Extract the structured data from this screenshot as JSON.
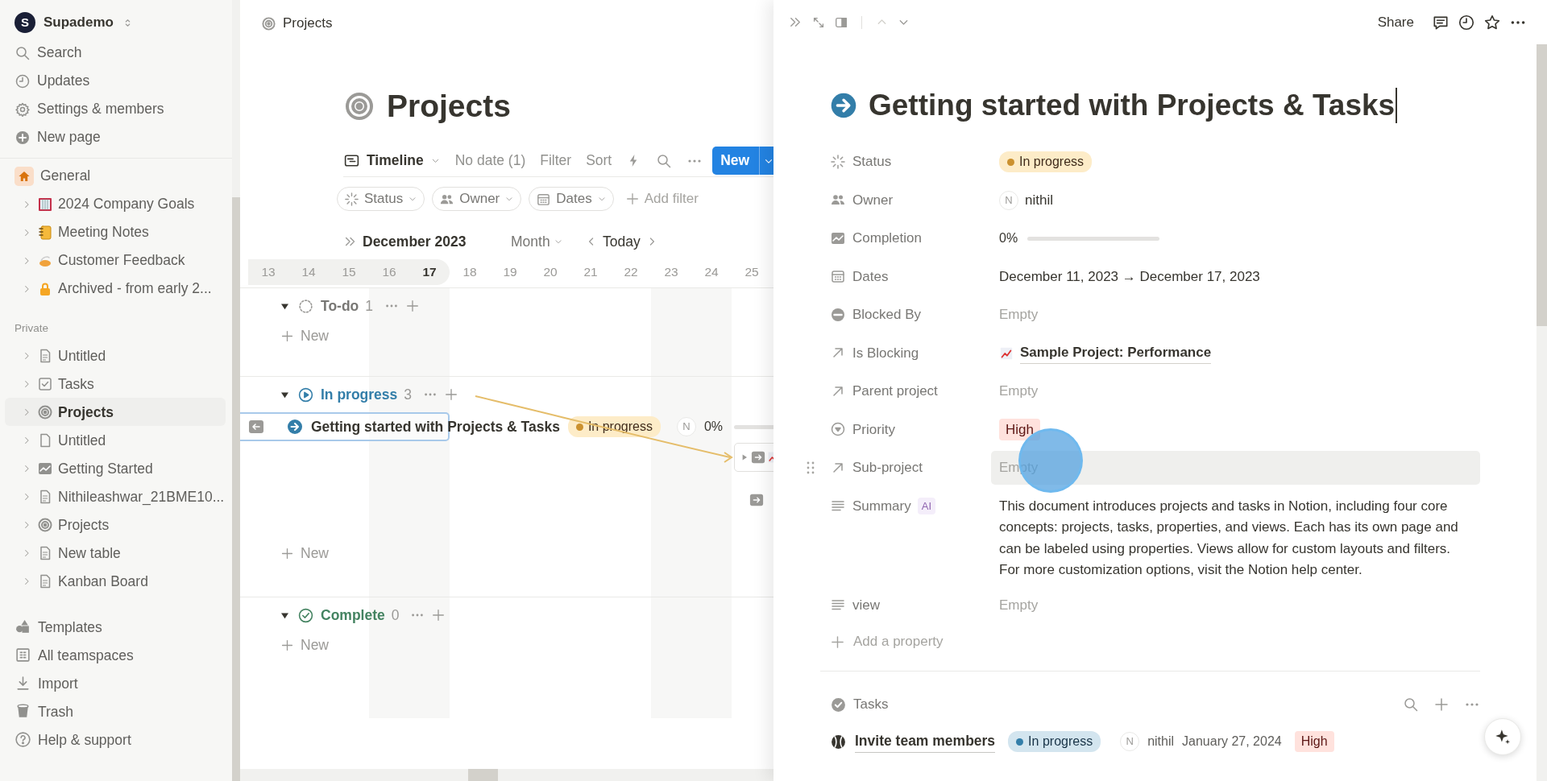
{
  "workspace": {
    "initial": "S",
    "name": "Supademo"
  },
  "sidebar": {
    "top_items": [
      {
        "label": "Search",
        "kind": "search"
      },
      {
        "label": "Updates",
        "kind": "clock"
      },
      {
        "label": "Settings & members",
        "kind": "gear"
      },
      {
        "label": "New page",
        "kind": "plus"
      }
    ],
    "teamspace": {
      "label": "General",
      "kind": "house"
    },
    "teamspace_items": [
      {
        "label": "2024 Company Goals",
        "kind": "frame",
        "selected": false
      },
      {
        "label": "Meeting Notes",
        "kind": "notebook",
        "selected": false
      },
      {
        "label": "Customer Feedback",
        "kind": "pie",
        "selected": false
      },
      {
        "label": "Archived - from early 2...",
        "kind": "lock",
        "selected": false
      }
    ],
    "private_label": "Private",
    "private_items": [
      {
        "label": "Untitled",
        "kind": "page",
        "selected": false
      },
      {
        "label": "Tasks",
        "kind": "tasks",
        "selected": false
      },
      {
        "label": "Projects",
        "kind": "target",
        "selected": true
      },
      {
        "label": "Untitled",
        "kind": "blank",
        "selected": false
      },
      {
        "label": "Getting Started",
        "kind": "chart",
        "selected": false
      },
      {
        "label": "Nithileashwar_21BME10...",
        "kind": "page",
        "selected": false
      },
      {
        "label": "Projects",
        "kind": "target",
        "selected": false
      },
      {
        "label": "New table",
        "kind": "page",
        "selected": false
      },
      {
        "label": "Kanban Board",
        "kind": "page",
        "selected": false
      }
    ],
    "bottom_items": [
      {
        "label": "Templates",
        "kind": "templates"
      },
      {
        "label": "All teamspaces",
        "kind": "building"
      },
      {
        "label": "Import",
        "kind": "import"
      },
      {
        "label": "Trash",
        "kind": "trash"
      },
      {
        "label": "Help & support",
        "kind": "help"
      }
    ]
  },
  "breadcrumb": "Projects",
  "database": {
    "title": "Projects",
    "view": "Timeline",
    "toolbar": [
      "No date (1)",
      "Filter",
      "Sort"
    ],
    "new_button": "New",
    "filters": [
      {
        "label": "Status",
        "kind": "status"
      },
      {
        "label": "Owner",
        "kind": "people"
      },
      {
        "label": "Dates",
        "kind": "calendar"
      }
    ],
    "add_filter": "Add filter",
    "timeline": {
      "month": "December 2023",
      "scale": "Month",
      "today": "Today",
      "days": [
        {
          "label": "13",
          "in_range": true,
          "today": false,
          "weekend": false
        },
        {
          "label": "14",
          "in_range": true,
          "today": false,
          "weekend": false
        },
        {
          "label": "15",
          "in_range": true,
          "today": false,
          "weekend": false
        },
        {
          "label": "16",
          "in_range": true,
          "today": false,
          "weekend": true
        },
        {
          "label": "17",
          "in_range": true,
          "today": true,
          "weekend": true
        },
        {
          "label": "18",
          "in_range": false,
          "today": false,
          "weekend": false
        },
        {
          "label": "19",
          "in_range": false,
          "today": false,
          "weekend": false
        },
        {
          "label": "20",
          "in_range": false,
          "today": false,
          "weekend": false
        },
        {
          "label": "21",
          "in_range": false,
          "today": false,
          "weekend": false
        },
        {
          "label": "22",
          "in_range": false,
          "today": false,
          "weekend": false
        },
        {
          "label": "23",
          "in_range": false,
          "today": false,
          "weekend": true
        },
        {
          "label": "24",
          "in_range": false,
          "today": false,
          "weekend": true
        },
        {
          "label": "25",
          "in_range": false,
          "today": false,
          "weekend": false
        }
      ]
    },
    "groups": [
      {
        "name": "To-do",
        "kind": "todo",
        "count": "1",
        "expanded": true,
        "new_label": "New"
      },
      {
        "name": "In progress",
        "kind": "progress",
        "count": "3",
        "expanded": true,
        "new_label": "New",
        "cards": [
          {
            "title": "Getting started with Projects & Tasks",
            "status": "In progress",
            "owner_initial": "N",
            "completion": "0%",
            "level": 0,
            "selected": true
          }
        ]
      },
      {
        "name": "Complete",
        "kind": "complete",
        "count": "0",
        "expanded": true,
        "new_label": "New"
      }
    ]
  },
  "detail": {
    "share": "Share",
    "title": "Getting started with Projects & Tasks",
    "properties": [
      {
        "label": "Status",
        "kind": "status",
        "value": "In progress",
        "empty": false,
        "hovered": false
      },
      {
        "label": "Owner",
        "kind": "person",
        "initial": "N",
        "value": "nithil",
        "empty": false,
        "hovered": false
      },
      {
        "label": "Completion",
        "kind": "progress",
        "value": "0%",
        "level": 0,
        "empty": false,
        "hovered": false
      },
      {
        "label": "Dates",
        "kind": "date",
        "value": "December 11, 2023 → December 17, 2023",
        "empty": false,
        "hovered": false
      },
      {
        "label": "Blocked By",
        "kind": "blocked",
        "value": "Empty",
        "empty": true,
        "hovered": false
      },
      {
        "label": "Is Blocking",
        "kind": "relation",
        "value": "Sample Project: Performance",
        "empty": false,
        "hovered": false
      },
      {
        "label": "Parent project",
        "kind": "relation",
        "value": "Empty",
        "empty": true,
        "hovered": false
      },
      {
        "label": "Priority",
        "kind": "select",
        "value": "High",
        "empty": false,
        "hovered": false
      },
      {
        "label": "Sub-project",
        "kind": "relation",
        "value": "Empty",
        "empty": true,
        "hovered": true
      },
      {
        "label": "Summary",
        "kind": "summary",
        "badge": "AI",
        "value": "This document introduces projects and tasks in Notion, including four core concepts: projects, tasks, properties, and views. Each has its own page and can be labeled using properties. Views allow for custom layouts and filters. For more customization options, visit the Notion help center.",
        "empty": false,
        "hovered": false
      },
      {
        "label": "view",
        "kind": "text",
        "value": "Empty",
        "empty": true,
        "hovered": false
      }
    ],
    "add_property": "Add a property",
    "tasks": {
      "title": "Tasks",
      "rows": [
        {
          "title": "Invite team members",
          "status": "In progress",
          "owner_initial": "N",
          "owner": "nithil",
          "date": "January 27, 2024",
          "priority": "High"
        }
      ]
    }
  }
}
